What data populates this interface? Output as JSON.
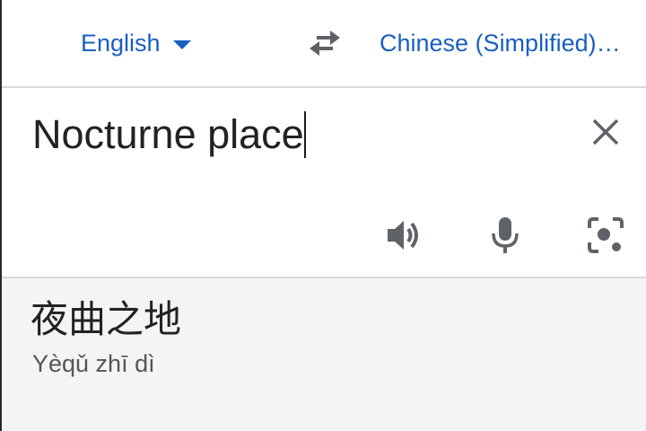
{
  "language_bar": {
    "source_language": "English",
    "target_language": "Chinese (Simplified)…"
  },
  "input": {
    "text": "Nocturne place"
  },
  "output": {
    "translation": "夜曲之地",
    "romanization": "Yèqǔ zhī dì"
  },
  "icons": {
    "dropdown": "chevron-down-icon",
    "swap": "swap-arrows-icon",
    "clear": "close-icon",
    "speaker": "speaker-icon",
    "mic": "microphone-icon",
    "camera": "camera-lens-icon"
  },
  "colors": {
    "accent": "#1a5fc0",
    "text": "#222222",
    "icon": "#5f6368",
    "output_background": "#f3f4f6",
    "divider": "#d9d9d9"
  }
}
